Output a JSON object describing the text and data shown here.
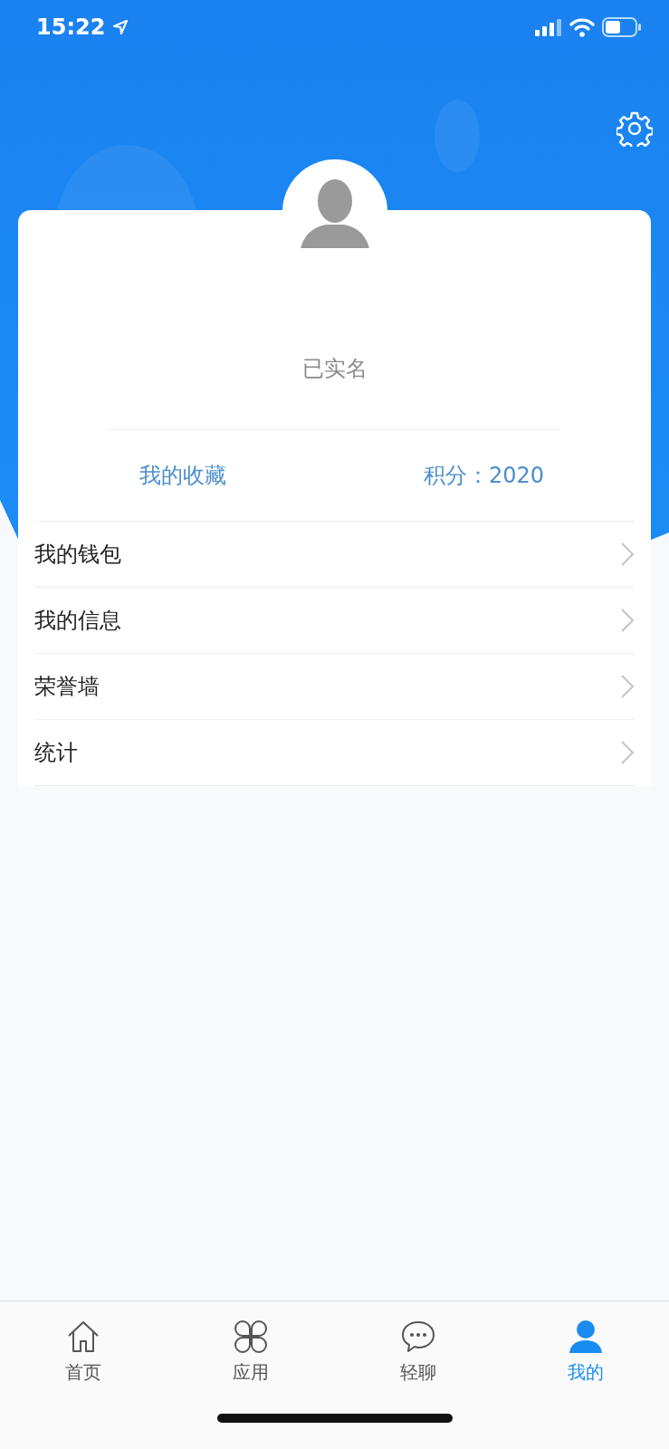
{
  "status_bar": {
    "time": "15:22"
  },
  "profile": {
    "verification": "已实名",
    "favorites_link": "我的收藏",
    "points": "积分：2020"
  },
  "menu": [
    {
      "label": "我的钱包"
    },
    {
      "label": "我的信息"
    },
    {
      "label": "荣誉墙"
    },
    {
      "label": "统计"
    }
  ],
  "tab_bar": [
    {
      "label": "首页",
      "kind": "home",
      "selected": false
    },
    {
      "label": "应用",
      "kind": "apps",
      "selected": false
    },
    {
      "label": "轻聊",
      "kind": "chat",
      "selected": false
    },
    {
      "label": "我的",
      "kind": "me",
      "selected": true
    }
  ]
}
